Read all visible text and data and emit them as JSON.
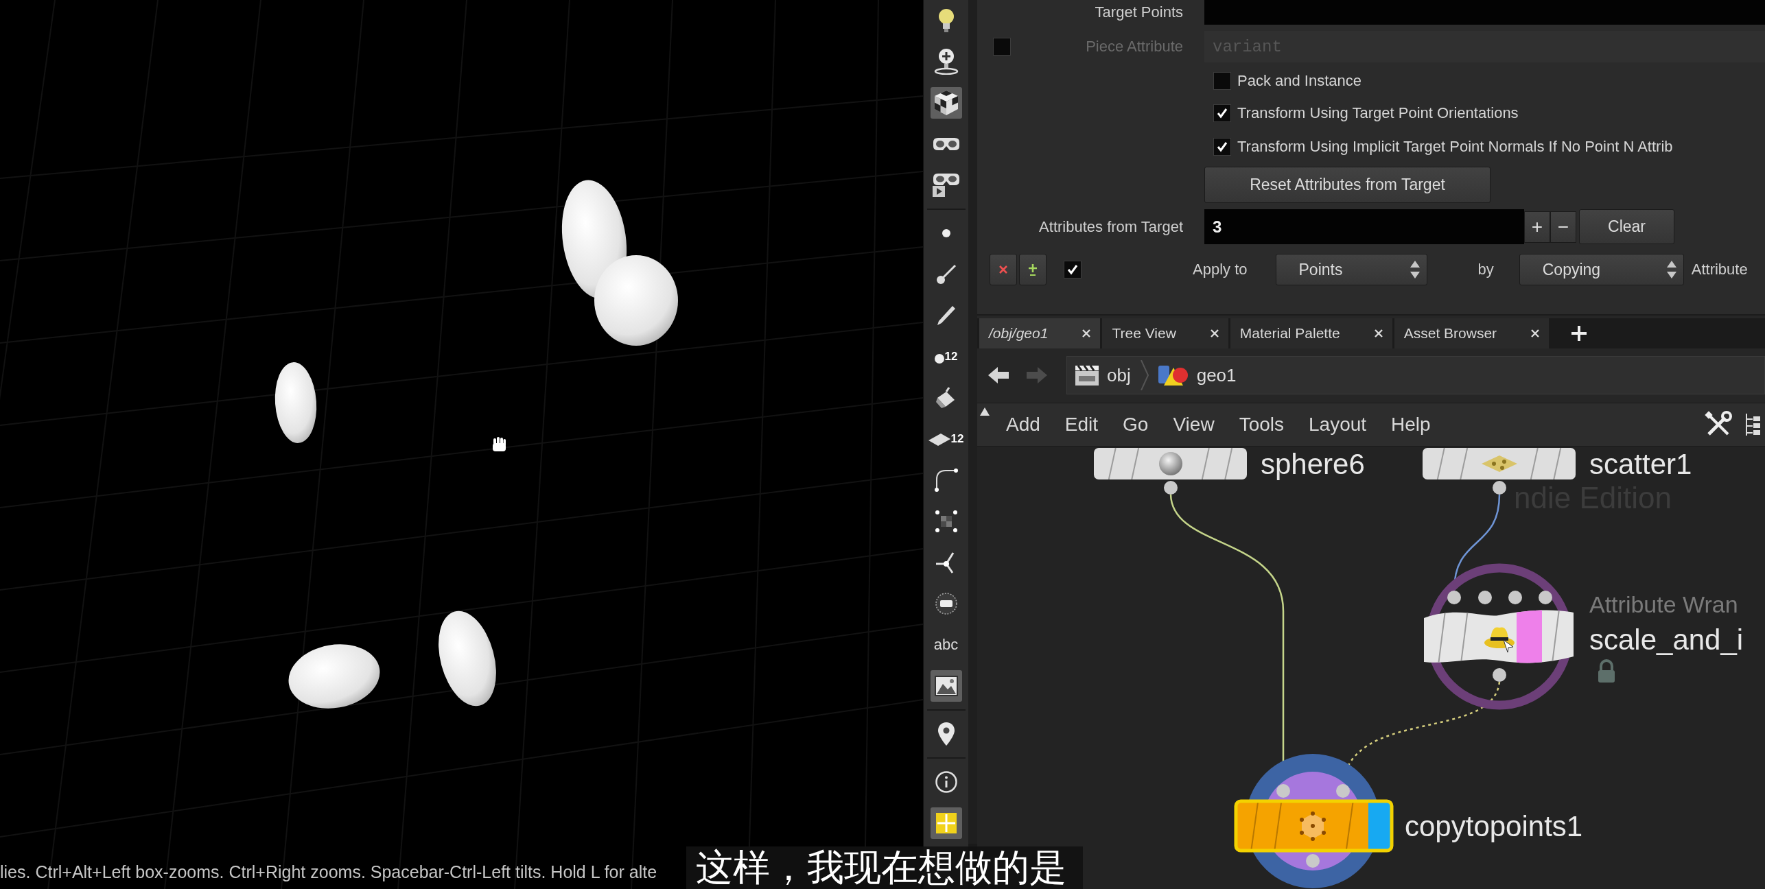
{
  "viewport": {
    "status_text": "lies. Ctrl+Alt+Left box-zooms. Ctrl+Right zooms. Spacebar-Ctrl-Left tilts. Hold L for alte"
  },
  "shelf": {
    "tool_groups": [
      [
        {
          "kind": "light",
          "on": false
        },
        {
          "kind": "light_add",
          "on": false
        },
        {
          "kind": "cube",
          "on": true
        },
        {
          "kind": "camera",
          "on": false
        },
        {
          "kind": "camera_play",
          "on": false
        }
      ],
      [
        {
          "kind": "dot",
          "on": false
        },
        {
          "kind": "brush",
          "on": false
        },
        {
          "kind": "pen",
          "on": false
        },
        {
          "kind": "point_number",
          "label": "12",
          "on": false
        },
        {
          "kind": "bucket",
          "on": false
        },
        {
          "kind": "prim_number",
          "label": "12",
          "on": false
        },
        {
          "kind": "curve",
          "on": false
        },
        {
          "kind": "grid_points",
          "on": false
        },
        {
          "kind": "axis",
          "on": false
        },
        {
          "kind": "circle_bar",
          "on": false
        },
        {
          "kind": "text",
          "label": "abc",
          "on": false
        },
        {
          "kind": "image",
          "on": true
        }
      ],
      [
        {
          "kind": "pin",
          "on": false
        }
      ],
      [
        {
          "kind": "info",
          "on": false
        },
        {
          "kind": "quad_grid",
          "on": true
        }
      ]
    ]
  },
  "parameters": {
    "rows": [
      {
        "kind": "field",
        "label": "Target Points",
        "disabled": false
      },
      {
        "kind": "field",
        "label": "Piece Attribute",
        "value": "variant",
        "toggle": false,
        "disabled": true
      },
      {
        "kind": "checkbox",
        "label": "Pack and Instance",
        "checked": false
      },
      {
        "kind": "checkbox",
        "label": "Transform Using Target Point Orientations",
        "checked": true
      },
      {
        "kind": "checkbox",
        "label": "Transform Using Implicit Target Point Normals If No Point N Attrib",
        "checked": true
      },
      {
        "kind": "button",
        "label": "Reset Attributes from Target"
      },
      {
        "kind": "multiparm",
        "label": "Attributes from Target",
        "value": "3",
        "add": "+",
        "remove": "−",
        "clear": "Clear"
      },
      {
        "kind": "instance",
        "enabled": true,
        "apply_label": "Apply to",
        "apply_value": "Points",
        "by_label": "by",
        "by_value": "Copying",
        "next_label": "Attribute"
      }
    ]
  },
  "network": {
    "tabs": [
      {
        "label": "/obj/geo1",
        "selected": true
      },
      {
        "label": "Tree View",
        "selected": false
      },
      {
        "label": "Material Palette",
        "selected": false
      },
      {
        "label": "Asset Browser",
        "selected": false
      }
    ],
    "history": [
      {
        "kind": "back",
        "disabled": false
      },
      {
        "kind": "forward",
        "disabled": true
      }
    ],
    "path": [
      {
        "kind": "obj",
        "label": "obj"
      },
      {
        "kind": "geo",
        "label": "geo1"
      }
    ],
    "menu": [
      "Add",
      "Edit",
      "Go",
      "View",
      "Tools",
      "Layout",
      "Help"
    ],
    "watermark": "ndie Edition",
    "nodes": [
      {
        "kind": "sphere",
        "name": "sphere6",
        "selected": false,
        "display": false,
        "template": false,
        "locked": false
      },
      {
        "kind": "scatter",
        "name": "scatter1",
        "selected": false,
        "display": false,
        "template": false,
        "locked": false
      },
      {
        "kind": "wrangle",
        "type": "Attribute Wran",
        "name": "scale_and_i",
        "selected": false,
        "display": false,
        "template": true,
        "locked": true
      },
      {
        "kind": "copytopoints",
        "name": "copytopoints1",
        "selected": true,
        "display": true,
        "template": false,
        "locked": false
      }
    ]
  },
  "subtitle": "这样，我现在想做的是"
}
